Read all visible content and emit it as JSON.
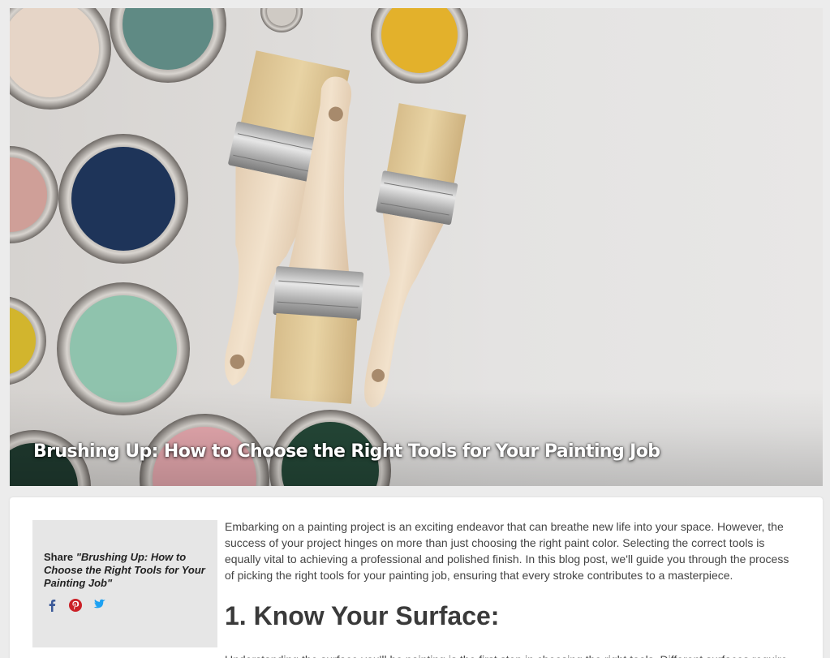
{
  "hero": {
    "title": "Brushing Up: How to Choose the Right Tools for Your Painting Job"
  },
  "share": {
    "prefix": "Share ",
    "post_title": "\"Brushing Up: How to Choose the Right Tools for Your Painting Job\"",
    "icons": [
      "facebook-icon",
      "pinterest-icon",
      "twitter-icon"
    ],
    "colors": {
      "facebook": "#3b5998",
      "pinterest": "#cb2027",
      "twitter": "#1da1f2"
    }
  },
  "article": {
    "intro": "Embarking on a painting project is an exciting endeavor that can breathe new life into your space. However, the success of your project hinges on more than just choosing the right paint color. Selecting the correct tools is equally vital to achieving a professional and polished finish. In this blog post, we'll guide you through the process of picking the right tools for your painting job, ensuring that every stroke contributes to a masterpiece.",
    "section_heading": "1. Know Your Surface:",
    "section_text": "Understanding the surface you'll be painting is the first step in choosing the right tools. Different surfaces require"
  }
}
